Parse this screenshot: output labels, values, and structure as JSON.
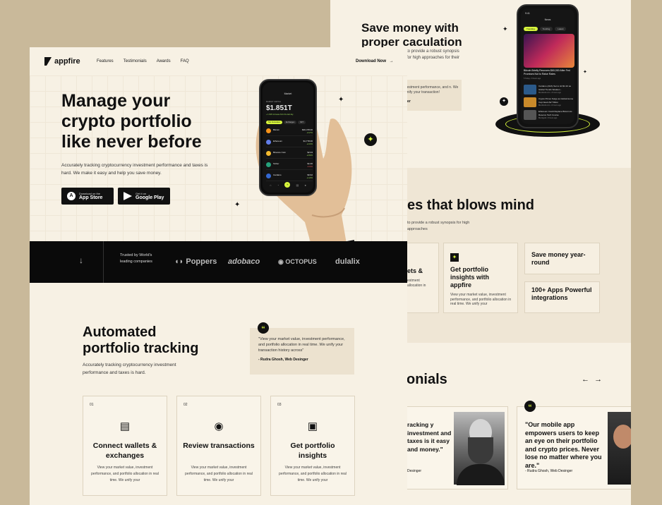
{
  "back": {
    "hero_title_1": "Save money with",
    "hero_title_2": "proper caculation",
    "hero_sub": "to provide a robust synopsis for high approaches for their",
    "quote_text": "vestment performance, and n. We unify your transaction!",
    "quote_author": "ger",
    "phone": {
      "time": "9:41",
      "header": "News",
      "tabs": [
        "Trending",
        "Tending",
        "Latest",
        "Price"
      ],
      "headline": "Bitcoin Briefly Recovers $60,000 After Fed Promises Not to Raise Rates",
      "headline_meta": "5 Today • 8 hours ago",
      "news": [
        {
          "title": "Cardano (ADA) Set to Hit $1.32 as Global Trends Weaken...",
          "meta": "Blockbold.com • 3 hours ago"
        },
        {
          "title": "Crypto Prices Surge as Global Home Cap Nears $2 Trillion",
          "meta": "Blockbold.com • 6 hours ago"
        },
        {
          "title": "Ethereum Could Replace Bitcoin As Reserve Tech Course",
          "meta": "Blockgold • 8 hours ago"
        }
      ]
    },
    "features_title": "es that blows mind",
    "features_sub": "to provide a robust synopsis for high approaches",
    "feat_cards": [
      {
        "title": "ets &",
        "desc": "estment allocation in"
      },
      {
        "title": "Get portfolio insights with appfire",
        "desc": "View your market value, investment performance, and portfolio allocation in real time. We unify your"
      },
      {
        "title": "Save money year-round",
        "desc": ""
      },
      {
        "title": "100+ Apps Powerful integrations",
        "desc": ""
      }
    ],
    "testimonials_title": "onials",
    "prev_arrow": "←",
    "next_arrow": "→",
    "testi_left_text": "racking y investment and taxes is it easy and money.\"",
    "testi_left_author": "Desinger",
    "testi_right_text": "\"Our mobile app empowers users to keep an eye on their portfolio and crypto prices. Never lose  no matter where you are.\"",
    "testi_right_author": "- Rudra Ghosh, Web Desinger"
  },
  "front": {
    "logo": "appfire",
    "nav": [
      "Features",
      "Testimonials",
      "Awards",
      "FAQ"
    ],
    "download_now": "Download Now",
    "hero_title": [
      "Manage your",
      "crypto portfolio",
      "like never before"
    ],
    "hero_sub": "Accurately tracking cryptocurrency investment performance and taxes is hard. We make it easy and help you save money.",
    "app_store": {
      "small": "Download on the",
      "large": "App Store"
    },
    "google_play": {
      "small": "Get it on",
      "large": "Google Play"
    },
    "phone": {
      "title": "Market",
      "label": "MARKET CAPITAL",
      "value": "$1.851T",
      "change": "+ 1.62% increase from the last day",
      "chips": [
        "Top Currencies",
        "Exchanges",
        "NFT"
      ],
      "coins": [
        {
          "name": "Bitcoin",
          "value": "$30,478.00",
          "pct": "+3.27%",
          "color": "#f7931a"
        },
        {
          "name": "Ethereum",
          "value": "$1,778.00",
          "pct": "+2.10%",
          "color": "#627eea"
        },
        {
          "name": "Binance Coin",
          "value": "$2.04",
          "pct": "+0.62%",
          "color": "#f3ba2f"
        },
        {
          "name": "Tether",
          "value": "$1.00",
          "pct": "-0.01%",
          "color": "#26a17b"
        },
        {
          "name": "Cardano",
          "value": "$0.62",
          "pct": "+1.22%",
          "color": "#3468d1"
        }
      ]
    },
    "trusted": "Trusted by World's leading companies",
    "brands": [
      "Poppers",
      "adobaco",
      "OCTOPUS",
      "dulalix"
    ],
    "sec2_title": [
      "Automated",
      "portfolio tracking"
    ],
    "sec2_sub": "Accurately tracking cryptocurrency investment performance and taxes is hard.",
    "quote_text": "\"View your market value, investment performance, and portfolio allocation in real time. We unify your transaction history across\"",
    "quote_author": "- Rudra Ghosh, Web Desinger",
    "cards": [
      {
        "num": "01",
        "title": "Connect wallets & exchanges",
        "desc": "View your market value, investment performance, and portfolio allocation in real time. We unify your",
        "icon": "wallet-icon"
      },
      {
        "num": "02",
        "title": "Review transactions",
        "desc": "View your market value, investment performance, and portfolio allocation in real time. We unify your",
        "icon": "eye-icon"
      },
      {
        "num": "03",
        "title": "Get portfolio insights",
        "desc": "View your market value, investment performance, and portfolio allocation in real time. We unify your",
        "icon": "insights-icon"
      }
    ]
  },
  "colors": {
    "accent": "#d7f53c",
    "dark": "#111111",
    "cream": "#f7f1e4",
    "backdrop": "#c9b99a"
  }
}
